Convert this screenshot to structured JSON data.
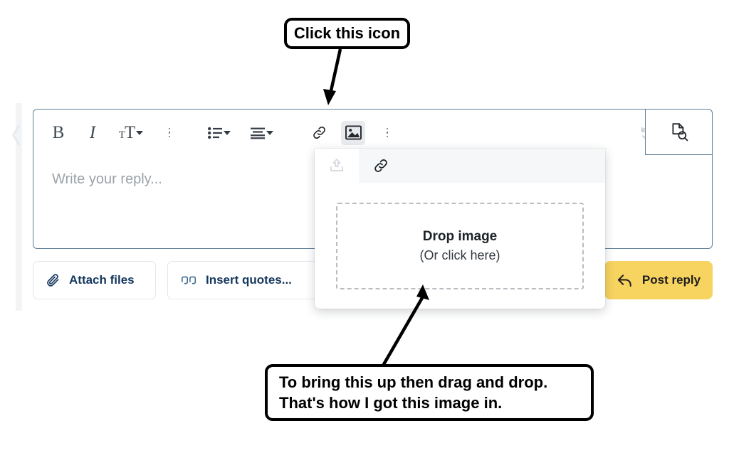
{
  "annotations": {
    "top_callout": "Click this icon",
    "bottom_callout_line1": "To bring this up then drag and drop.",
    "bottom_callout_line2": "That's how I got this image in."
  },
  "editor": {
    "placeholder": "Write your reply...",
    "toolbar": {
      "bold_label": "B",
      "italic_label": "I",
      "font_size_small": "T",
      "font_size_large": "T",
      "icons": [
        "bold-icon",
        "italic-icon",
        "font-size-icon",
        "more-text-options-icon",
        "bulleted-list-icon",
        "align-icon",
        "link-icon",
        "image-icon",
        "more-insert-options-icon",
        "undo-icon",
        "more-options-icon",
        "preview-icon"
      ],
      "image_button_state": "active",
      "undo_button_state": "disabled"
    }
  },
  "image_popup": {
    "tabs": [
      {
        "name": "upload-tab",
        "icon": "upload-icon",
        "state": "active"
      },
      {
        "name": "link-tab",
        "icon": "link-icon",
        "state": "inactive"
      }
    ],
    "dropzone_title": "Drop image",
    "dropzone_subtitle": "(Or click here)"
  },
  "actions": {
    "attach_files_label": "Attach files",
    "insert_quotes_label": "Insert quotes...",
    "post_reply_label": "Post reply"
  },
  "colors": {
    "post_reply_bg": "#f7d35f",
    "link_text": "#14375e",
    "editor_border": "#5e7f96",
    "placeholder_text": "#9ca3a9",
    "dropzone_border": "#b9bdc2"
  }
}
